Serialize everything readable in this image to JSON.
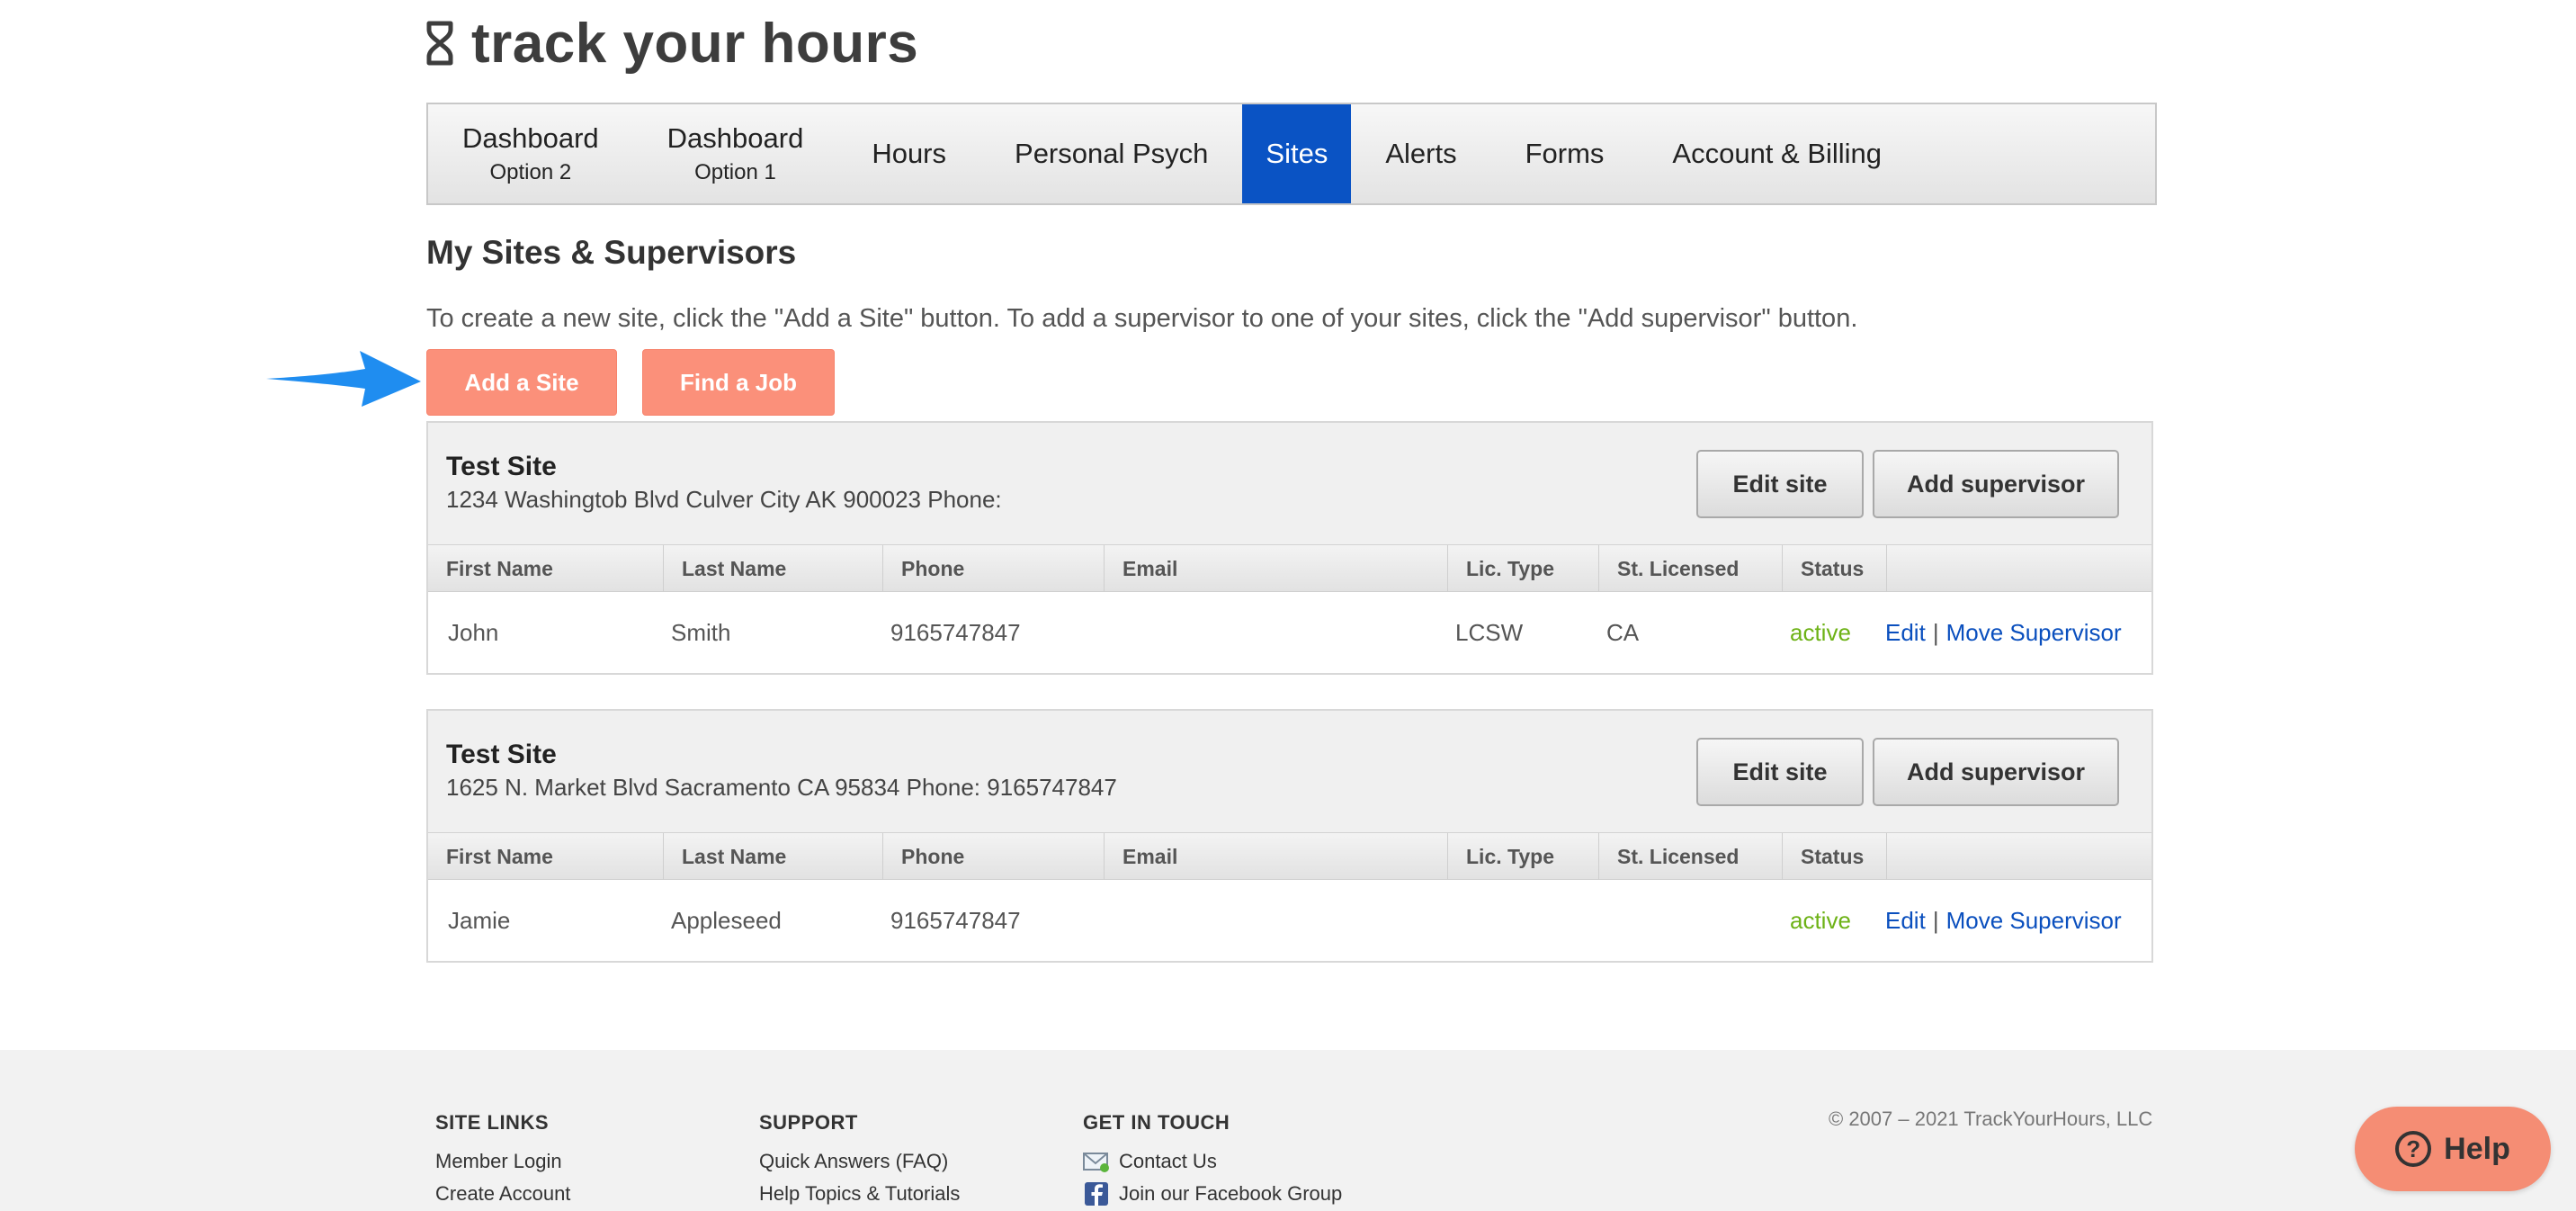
{
  "brand": {
    "logo_text": "track your hours",
    "logo_icon": "hourglass-icon"
  },
  "nav": {
    "items": [
      {
        "label": "Dashboard",
        "sub": "Option 2"
      },
      {
        "label": "Dashboard",
        "sub": "Option 1"
      },
      {
        "label": "Hours"
      },
      {
        "label": "Personal Psych"
      },
      {
        "label": "Sites",
        "active": true
      },
      {
        "label": "Alerts"
      },
      {
        "label": "Forms"
      },
      {
        "label": "Account & Billing"
      }
    ]
  },
  "page": {
    "title": "My Sites & Supervisors",
    "instructions": "To create a new site, click the \"Add a Site\" button. To add a supervisor to one of your sites, click the \"Add supervisor\" button.",
    "add_site_label": "Add a Site",
    "find_job_label": "Find a Job"
  },
  "columns": [
    "First Name",
    "Last Name",
    "Phone",
    "Email",
    "Lic. Type",
    "St. Licensed",
    "Status",
    ""
  ],
  "sites": [
    {
      "name": "Test Site",
      "address": "1234 Washingtob Blvd Culver City AK 900023 Phone:",
      "edit_label": "Edit site",
      "add_sup_label": "Add supervisor",
      "rows": [
        {
          "first": "John",
          "last": "Smith",
          "phone": "9165747847",
          "email": "",
          "lic": "LCSW",
          "state": "CA",
          "status": "active",
          "edit": "Edit",
          "move": "Move Supervisor"
        }
      ]
    },
    {
      "name": "Test Site",
      "address": "1625 N. Market Blvd Sacramento CA 95834 Phone: 9165747847",
      "edit_label": "Edit site",
      "add_sup_label": "Add supervisor",
      "rows": [
        {
          "first": "Jamie",
          "last": "Appleseed",
          "phone": "9165747847",
          "email": "",
          "lic": "",
          "state": "",
          "status": "active",
          "edit": "Edit",
          "move": "Move Supervisor"
        }
      ]
    }
  ],
  "footer": {
    "site_links": {
      "heading": "SITE LINKS",
      "links": [
        "Member Login",
        "Create Account"
      ]
    },
    "support": {
      "heading": "SUPPORT",
      "links": [
        "Quick Answers (FAQ)",
        "Help Topics & Tutorials"
      ]
    },
    "contact": {
      "heading": "GET IN TOUCH",
      "links": [
        "Contact Us",
        "Join our Facebook Group"
      ]
    },
    "copyright": "© 2007 – 2021 TrackYourHours, LLC"
  },
  "help_label": "Help",
  "colors": {
    "accent": "#0a53c4",
    "button_orange": "#fb907a",
    "status_active": "#6db216"
  }
}
